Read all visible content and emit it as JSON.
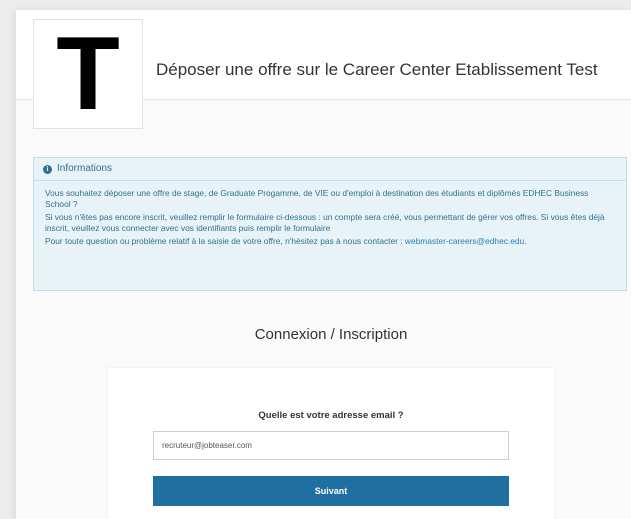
{
  "header": {
    "logo_letter": "T",
    "title": "Déposer une offre sur le Career Center Etablissement Test"
  },
  "info_panel": {
    "icon": "info-circle-icon",
    "heading": "Informations",
    "paragraph_1": "Vous souhaitez déposer une offre de stage, de Graduate Progamme, de VIE ou d'emploi à destination des étudiants et diplômés EDHEC Business School ?",
    "paragraph_2": "Si vous n'êtes pas encore inscrit, veuillez remplir le formulaire ci-dessous : un compte sera créé, vous permettant de gérer vos offres. Si vous êtes déjà inscrit, veuillez vous connecter avec vos identifiants puis remplir le formulaire",
    "paragraph_3_text": "Pour toute question ou problème relatif à la saisie de votre offre, n'hésitez pas à nous contacter : ",
    "contact_email": "webmaster-careers@edhec.edu",
    "paragraph_3_end": "."
  },
  "login": {
    "section_title": "Connexion / Inscription",
    "question": "Quelle est votre adresse email ?",
    "email_value": "recruteur@jobteaser.com",
    "next_button": "Suivant"
  },
  "colors": {
    "info_background": "#e8f3f8",
    "info_text": "#31708f",
    "primary_button": "#1f6fa0"
  }
}
